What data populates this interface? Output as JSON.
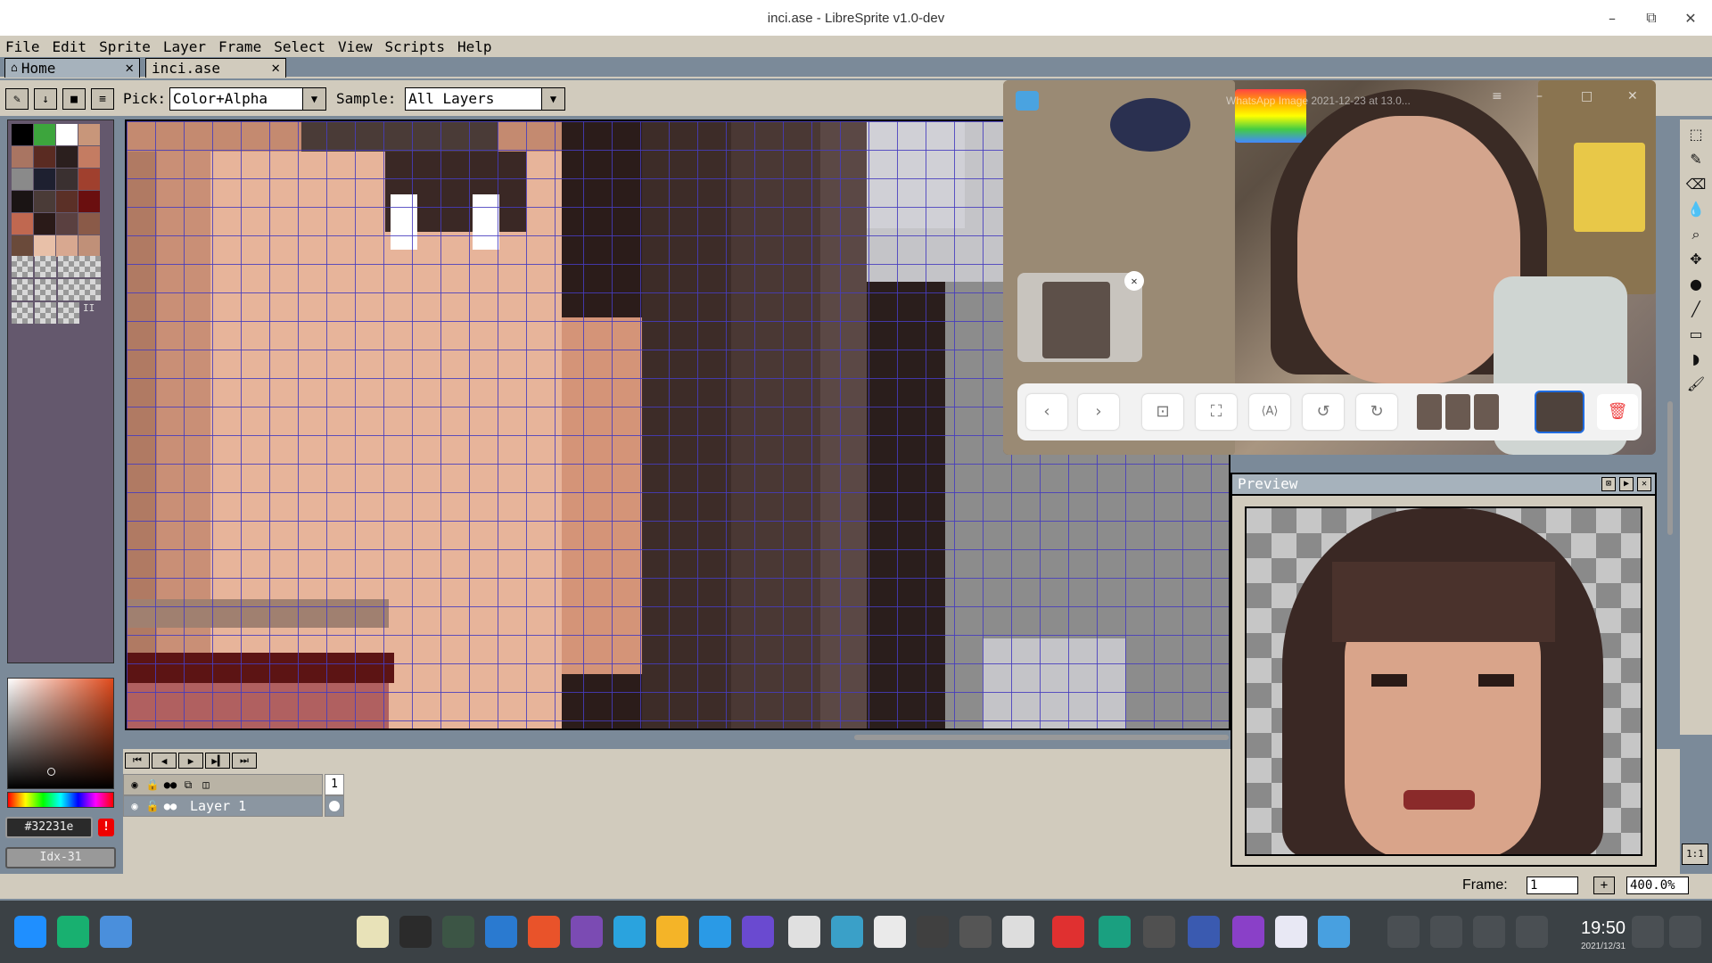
{
  "window": {
    "title": "inci.ase - LibreSprite v1.0-dev",
    "min": "–",
    "max": "⧉",
    "close": "✕"
  },
  "menu": [
    "File",
    "Edit",
    "Sprite",
    "Layer",
    "Frame",
    "Select",
    "View",
    "Scripts",
    "Help"
  ],
  "tabs": {
    "home": "Home",
    "file": "inci.ase",
    "close": "✕"
  },
  "context": {
    "pick_label": "Pick:",
    "pick_value": "Color+Alpha",
    "sample_label": "Sample:",
    "sample_value": "All Layers"
  },
  "palette": {
    "colors": [
      "#000000",
      "#3da53d",
      "#ffffff",
      "#c8967a",
      "#a97562",
      "#5a2b22",
      "#2b1f1e",
      "#c47c62",
      "#8a8a8a",
      "#1e2030",
      "#3a3030",
      "#a0402e",
      "#1a1414",
      "#4a3b37",
      "#5b3027",
      "#6a0f0f",
      "#c06850",
      "#2a1a18",
      "#5a4040",
      "#8a5a48",
      "#6a4a3a",
      "#e8c0a8",
      "#d8a890",
      "#c09078"
    ],
    "marker": "II"
  },
  "color": {
    "hex": "#32231e",
    "index": "Idx-31",
    "warn": "!"
  },
  "timeline": {
    "frame_number": "1",
    "layer_name": "Layer 1"
  },
  "tools": [
    "⬚",
    "✎",
    "⌫",
    "💧",
    "⌕",
    "✥",
    "●",
    "╱",
    "▭",
    "◗",
    "🖌"
  ],
  "zoom_one": "1:1",
  "status": {
    "frame_label": "Frame:",
    "frame_value": "1",
    "plus": "+",
    "zoom": "400.0%"
  },
  "viewer": {
    "title": "WhatsApp Image 2021-12-23 at 13.0...",
    "ctrl_menu": "≡",
    "ctrl_min": "–",
    "ctrl_max": "□",
    "ctrl_close": "✕",
    "thumb_close": "✕",
    "buttons": [
      "‹",
      "›",
      "⊡",
      "⛶",
      "⟨A⟩",
      "↺",
      "↻"
    ],
    "delete": "🗑"
  },
  "preview": {
    "title": "Preview",
    "b1": "⊠",
    "b2": "▶",
    "b3": "✕"
  },
  "clock": {
    "time": "19:50",
    "date": "2021/12/31"
  }
}
